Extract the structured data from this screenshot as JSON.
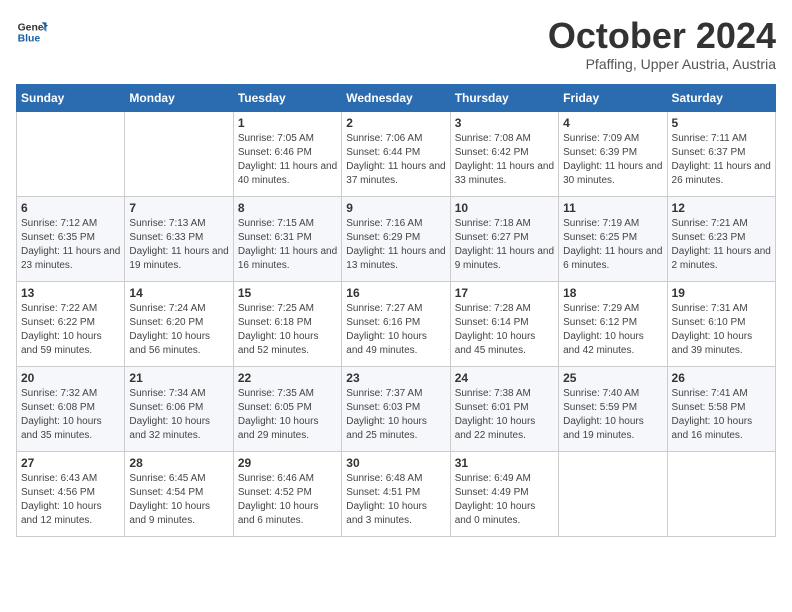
{
  "header": {
    "logo_line1": "General",
    "logo_line2": "Blue",
    "month": "October 2024",
    "location": "Pfaffing, Upper Austria, Austria"
  },
  "days_of_week": [
    "Sunday",
    "Monday",
    "Tuesday",
    "Wednesday",
    "Thursday",
    "Friday",
    "Saturday"
  ],
  "weeks": [
    [
      {
        "day": "",
        "info": ""
      },
      {
        "day": "",
        "info": ""
      },
      {
        "day": "1",
        "info": "Sunrise: 7:05 AM\nSunset: 6:46 PM\nDaylight: 11 hours and 40 minutes."
      },
      {
        "day": "2",
        "info": "Sunrise: 7:06 AM\nSunset: 6:44 PM\nDaylight: 11 hours and 37 minutes."
      },
      {
        "day": "3",
        "info": "Sunrise: 7:08 AM\nSunset: 6:42 PM\nDaylight: 11 hours and 33 minutes."
      },
      {
        "day": "4",
        "info": "Sunrise: 7:09 AM\nSunset: 6:39 PM\nDaylight: 11 hours and 30 minutes."
      },
      {
        "day": "5",
        "info": "Sunrise: 7:11 AM\nSunset: 6:37 PM\nDaylight: 11 hours and 26 minutes."
      }
    ],
    [
      {
        "day": "6",
        "info": "Sunrise: 7:12 AM\nSunset: 6:35 PM\nDaylight: 11 hours and 23 minutes."
      },
      {
        "day": "7",
        "info": "Sunrise: 7:13 AM\nSunset: 6:33 PM\nDaylight: 11 hours and 19 minutes."
      },
      {
        "day": "8",
        "info": "Sunrise: 7:15 AM\nSunset: 6:31 PM\nDaylight: 11 hours and 16 minutes."
      },
      {
        "day": "9",
        "info": "Sunrise: 7:16 AM\nSunset: 6:29 PM\nDaylight: 11 hours and 13 minutes."
      },
      {
        "day": "10",
        "info": "Sunrise: 7:18 AM\nSunset: 6:27 PM\nDaylight: 11 hours and 9 minutes."
      },
      {
        "day": "11",
        "info": "Sunrise: 7:19 AM\nSunset: 6:25 PM\nDaylight: 11 hours and 6 minutes."
      },
      {
        "day": "12",
        "info": "Sunrise: 7:21 AM\nSunset: 6:23 PM\nDaylight: 11 hours and 2 minutes."
      }
    ],
    [
      {
        "day": "13",
        "info": "Sunrise: 7:22 AM\nSunset: 6:22 PM\nDaylight: 10 hours and 59 minutes."
      },
      {
        "day": "14",
        "info": "Sunrise: 7:24 AM\nSunset: 6:20 PM\nDaylight: 10 hours and 56 minutes."
      },
      {
        "day": "15",
        "info": "Sunrise: 7:25 AM\nSunset: 6:18 PM\nDaylight: 10 hours and 52 minutes."
      },
      {
        "day": "16",
        "info": "Sunrise: 7:27 AM\nSunset: 6:16 PM\nDaylight: 10 hours and 49 minutes."
      },
      {
        "day": "17",
        "info": "Sunrise: 7:28 AM\nSunset: 6:14 PM\nDaylight: 10 hours and 45 minutes."
      },
      {
        "day": "18",
        "info": "Sunrise: 7:29 AM\nSunset: 6:12 PM\nDaylight: 10 hours and 42 minutes."
      },
      {
        "day": "19",
        "info": "Sunrise: 7:31 AM\nSunset: 6:10 PM\nDaylight: 10 hours and 39 minutes."
      }
    ],
    [
      {
        "day": "20",
        "info": "Sunrise: 7:32 AM\nSunset: 6:08 PM\nDaylight: 10 hours and 35 minutes."
      },
      {
        "day": "21",
        "info": "Sunrise: 7:34 AM\nSunset: 6:06 PM\nDaylight: 10 hours and 32 minutes."
      },
      {
        "day": "22",
        "info": "Sunrise: 7:35 AM\nSunset: 6:05 PM\nDaylight: 10 hours and 29 minutes."
      },
      {
        "day": "23",
        "info": "Sunrise: 7:37 AM\nSunset: 6:03 PM\nDaylight: 10 hours and 25 minutes."
      },
      {
        "day": "24",
        "info": "Sunrise: 7:38 AM\nSunset: 6:01 PM\nDaylight: 10 hours and 22 minutes."
      },
      {
        "day": "25",
        "info": "Sunrise: 7:40 AM\nSunset: 5:59 PM\nDaylight: 10 hours and 19 minutes."
      },
      {
        "day": "26",
        "info": "Sunrise: 7:41 AM\nSunset: 5:58 PM\nDaylight: 10 hours and 16 minutes."
      }
    ],
    [
      {
        "day": "27",
        "info": "Sunrise: 6:43 AM\nSunset: 4:56 PM\nDaylight: 10 hours and 12 minutes."
      },
      {
        "day": "28",
        "info": "Sunrise: 6:45 AM\nSunset: 4:54 PM\nDaylight: 10 hours and 9 minutes."
      },
      {
        "day": "29",
        "info": "Sunrise: 6:46 AM\nSunset: 4:52 PM\nDaylight: 10 hours and 6 minutes."
      },
      {
        "day": "30",
        "info": "Sunrise: 6:48 AM\nSunset: 4:51 PM\nDaylight: 10 hours and 3 minutes."
      },
      {
        "day": "31",
        "info": "Sunrise: 6:49 AM\nSunset: 4:49 PM\nDaylight: 10 hours and 0 minutes."
      },
      {
        "day": "",
        "info": ""
      },
      {
        "day": "",
        "info": ""
      }
    ]
  ]
}
